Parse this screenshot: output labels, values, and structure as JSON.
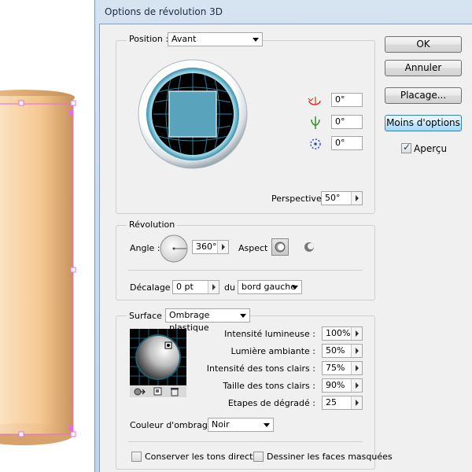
{
  "window": {
    "title": "Options de révolution 3D"
  },
  "buttons": {
    "ok": "OK",
    "cancel": "Annuler",
    "mapping": "Placage...",
    "fewer_options": "Moins d'options"
  },
  "preview": {
    "label": "Aperçu",
    "checked": true
  },
  "position": {
    "label": "Position :",
    "value": "Avant",
    "rot_x": "0°",
    "rot_y": "0°",
    "rot_z": "0°",
    "perspective_label": "Perspective :",
    "perspective_value": "50°"
  },
  "revolution": {
    "title": "Révolution",
    "angle_label": "Angle :",
    "angle_value": "360°",
    "aspect_label": "Aspect :",
    "offset_label": "Décalage :",
    "offset_value": "0 pt",
    "from_label": "du",
    "from_value": "bord gauche"
  },
  "surface": {
    "label": "Surface :",
    "value": "Ombrage plastique",
    "params": [
      {
        "label": "Intensité lumineuse :",
        "value": "100%"
      },
      {
        "label": "Lumière ambiante :",
        "value": "50%"
      },
      {
        "label": "Intensité des tons clairs :",
        "value": "75%"
      },
      {
        "label": "Taille des tons clairs :",
        "value": "90%"
      },
      {
        "label": "Etapes de dégradé :",
        "value": "25"
      }
    ],
    "shading_color_label": "Couleur d'ombrage :",
    "shading_color_value": "Noir",
    "preserve_spot_label": "Conserver les tons directs",
    "draw_hidden_label": "Dessiner les faces masquées"
  },
  "colors": {
    "accent": "#5aa3bd",
    "selection": "#e46ee0",
    "cylinder": "#f5c48c"
  }
}
